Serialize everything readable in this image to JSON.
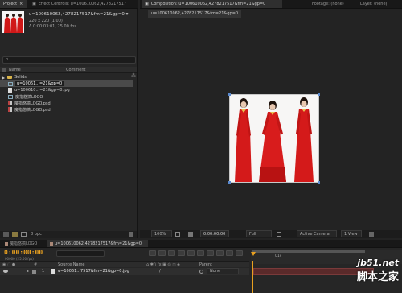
{
  "project_panel": {
    "tab_label": "Project",
    "effect_controls_tab": "Effect Controls: u=100610062,4278217517",
    "footage_name": "u=100610062,4278217517&fm=21&gp=0 ▾",
    "footage_size": "220 x 220 (1.00)",
    "footage_duration": "Δ 0:00:03:01, 25.00 fps",
    "search_placeholder": "ρ",
    "col_name": "Name",
    "col_comment": "Comment",
    "items": [
      {
        "label": "Solids",
        "icon": "folder-icon"
      },
      {
        "label": "u=10061...=21&gp=0",
        "icon": "composition-icon"
      },
      {
        "label": "u=100610...=21&gp=0.jpg",
        "icon": "image-file-icon"
      },
      {
        "label": "魔指悠搞LOGO",
        "icon": "composition-icon"
      },
      {
        "label": "魔指悠搞LOGO.psd",
        "icon": "psd-file-icon"
      },
      {
        "label": "魔指悠搞LOGO.psd",
        "icon": "psd-file-icon"
      }
    ],
    "bpc_label": "8 bpc"
  },
  "composition_panel": {
    "tab_label": "Composition: u=100610062,4278217517&fm=21&gp=0",
    "footage_tab": "Footage: (none)",
    "layer_tab": "Layer: (none)",
    "subtab": "u=100610062,4278217517&fm=21&gp=0",
    "zoom": "100%",
    "timecode": "0:00:00:00",
    "resolution": "Full",
    "camera": "Active Camera",
    "view": "1 View"
  },
  "timeline": {
    "tab1": "魔指悠搞LOGO",
    "tab2": "u=100610062,4278217517&fm=21&gp=0",
    "timecode": "0:00:00:00",
    "frame_info": "00000 (25.00 fps)",
    "col_source": "Source Name",
    "col_parent": "Parent",
    "layer_number": "1",
    "layer_name": "u=10061...7517&fm=21&gp=0.jpg",
    "parent_value": "None",
    "ruler_mark": "01s"
  },
  "watermark": {
    "line1": "jb51.net",
    "line2": "脚本之家"
  },
  "colors": {
    "accent_orange": "#e8a020",
    "blue_highlight": "#3a6aa8",
    "dress_red": "#d01818"
  }
}
